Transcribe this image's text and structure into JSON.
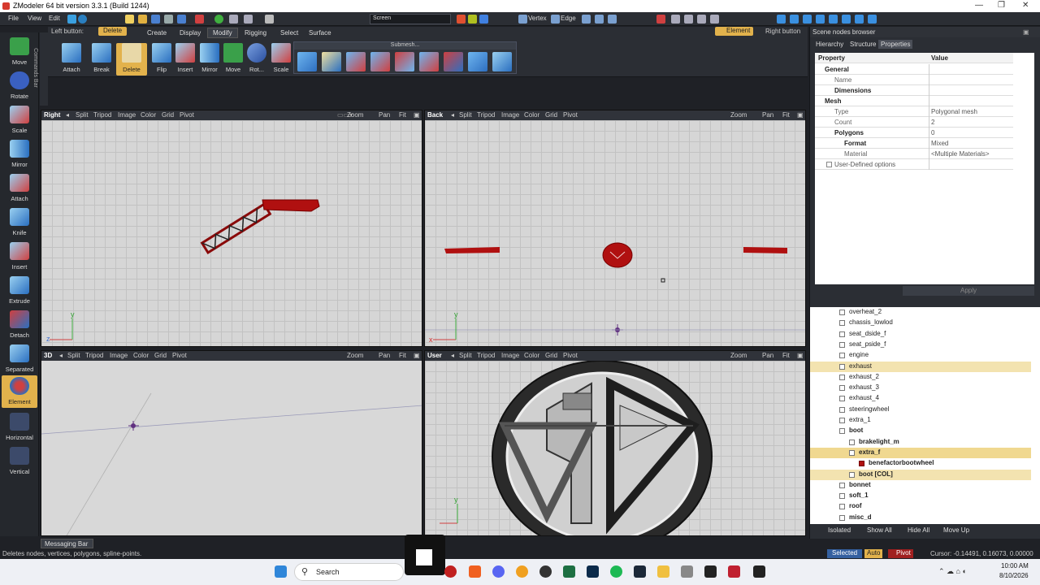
{
  "window": {
    "title": "ZModeler 64 bit version 3.3.1 (Build 1244)"
  },
  "menu": {
    "file": "File",
    "view": "View",
    "edit": "Edit",
    "screen_mode": "Screen",
    "vertex": "Vertex",
    "edge": "Edge"
  },
  "mouse": {
    "left_label": "Left button:",
    "left_value": "Delete",
    "right_value": "Element",
    "right_label": "Right button"
  },
  "tabs": [
    "Create",
    "Display",
    "Modify",
    "Rigging",
    "Select",
    "Surface"
  ],
  "active_tab": "Modify",
  "ribbon": {
    "buttons": [
      "Attach",
      "Break",
      "Delete",
      "Flip",
      "Insert",
      "Mirror",
      "Move",
      "Rot...",
      "Scale"
    ],
    "submesh_label": "Submesh..."
  },
  "lefttools": [
    "Move",
    "Rotate",
    "Scale",
    "Mirror",
    "Attach",
    "Knife",
    "Insert",
    "Extrude",
    "Detach",
    "Separated",
    "Element",
    "Horizontal",
    "Vertical"
  ],
  "commands_bar": "Commands Bar",
  "viewports": {
    "common": {
      "split": "Split",
      "tripod": "Tripod",
      "image": "Image",
      "color": "Color",
      "grid": "Grid",
      "pivot": "Pivot",
      "zoom": "Zoom",
      "pan": "Pan",
      "fit": "Fit"
    },
    "right": "Right",
    "back": "Back",
    "threed": "3D",
    "user": "User"
  },
  "scene": {
    "title": "Scene nodes browser",
    "tabs": [
      "Hierarchy",
      "Structure",
      "Properties"
    ],
    "prop_header": {
      "property": "Property",
      "value": "Value"
    },
    "properties": [
      {
        "k": "General",
        "v": ""
      },
      {
        "k": "Name",
        "v": ""
      },
      {
        "k": "Dimensions",
        "v": ""
      },
      {
        "k": "Mesh",
        "v": ""
      },
      {
        "k": "Type",
        "v": "Polygonal mesh"
      },
      {
        "k": "Count",
        "v": "2"
      },
      {
        "k": "Polygons",
        "v": "0"
      },
      {
        "k": "Format",
        "v": "Mixed"
      },
      {
        "k": "Material",
        "v": "<Multiple Materials>"
      },
      {
        "k": "User-Defined options",
        "v": ""
      }
    ],
    "apply": "Apply",
    "tree": [
      "overheat_2",
      "chassis_lowlod",
      "seat_dside_f",
      "seat_pside_f",
      "engine",
      "exhaust",
      "exhaust_2",
      "exhaust_3",
      "exhaust_4",
      "steeringwheel",
      "extra_1",
      "boot",
      "brakelight_m",
      "extra_f",
      "benefactorbootwheel",
      "boot [COL]",
      "bonnet",
      "soft_1",
      "roof",
      "misc_d"
    ],
    "bottom": {
      "isolated": "Isolated",
      "show_all": "Show All",
      "hide_all": "Hide All",
      "move_up": "Move Up"
    }
  },
  "messaging": "Messaging Bar",
  "status": {
    "text": "Deletes nodes, vertices, polygons, spline-points.",
    "selected": "Selected",
    "auto": "Auto",
    "pivot": "Pivot",
    "cursor": "Cursor: -0.14491, 0.16073, 0.00000"
  },
  "taskbar": {
    "search": "Search",
    "time": "10:00 AM",
    "date": "8/10/2026"
  },
  "colors": {
    "accent": "#e2b24c",
    "panel": "#2b2e34",
    "viewport": "#d6d6d6",
    "mesh": "#b01010"
  }
}
